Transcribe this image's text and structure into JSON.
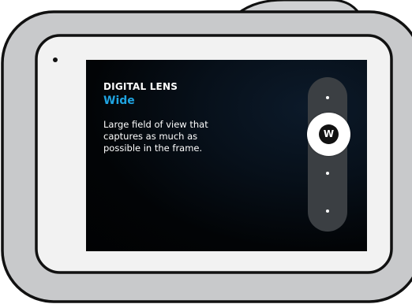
{
  "lens_overlay": {
    "title": "DIGITAL LENS",
    "selected_value": "Wide",
    "description_lines": [
      "Large field of view that",
      "captures as much as",
      "possible in the frame."
    ]
  },
  "lens_selector": {
    "selected_badge": "W",
    "options_count": 4,
    "selected_index": 1
  },
  "colors": {
    "accent": "#1fa3e0",
    "camera_body": "#c8c9cb",
    "bezel": "#f2f2f2",
    "screen": "#030508"
  }
}
